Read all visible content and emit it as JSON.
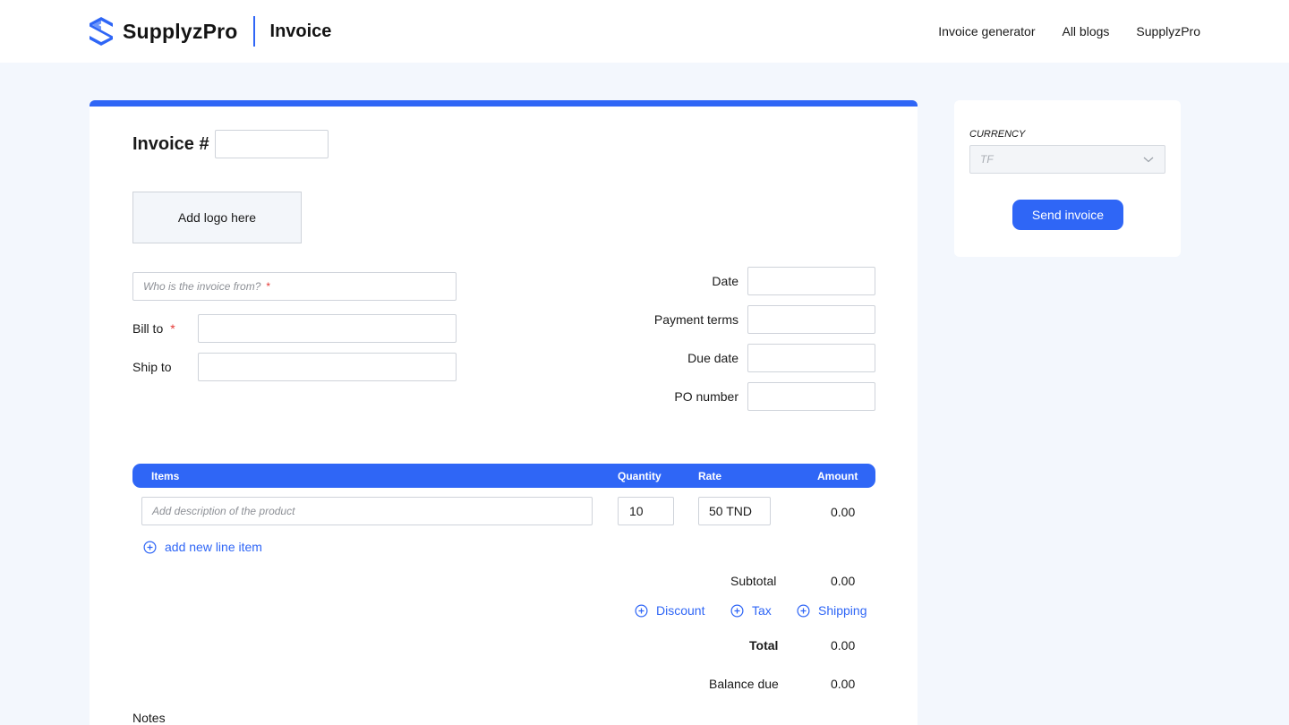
{
  "header": {
    "brand_name": "SupplyzPro",
    "page_title": "Invoice",
    "nav": [
      "Invoice generator",
      "All blogs",
      "SupplyzPro"
    ],
    "accent_color": "#2f66f6"
  },
  "invoice": {
    "title": "Invoice #",
    "number_value": "",
    "logo_placeholder": "Add logo here",
    "from_placeholder": "Who is the invoice from?",
    "required_mark": "*",
    "bill_to_label": "Bill to",
    "ship_to_label": "Ship to",
    "date_label": "Date",
    "payment_terms_label": "Payment terms",
    "due_date_label": "Due date",
    "po_number_label": "PO number"
  },
  "items": {
    "headers": {
      "items": "Items",
      "quantity": "Quantity",
      "rate": "Rate",
      "amount": "Amount"
    },
    "rows": [
      {
        "description_placeholder": "Add description of the product",
        "quantity": "10",
        "rate": "50 TND",
        "amount": "0.00"
      }
    ],
    "add_line": "add new line item"
  },
  "totals": {
    "subtotal_label": "Subtotal",
    "subtotal": "0.00",
    "discount_label": "Discount",
    "tax_label": "Tax",
    "shipping_label": "Shipping",
    "total_label": "Total",
    "total": "0.00",
    "balance_label": "Balance due",
    "balance": "0.00",
    "notes_label": "Notes"
  },
  "sidebar": {
    "currency_label": "CURRENCY",
    "currency_value": "TF",
    "send_label": "Send invoice"
  }
}
